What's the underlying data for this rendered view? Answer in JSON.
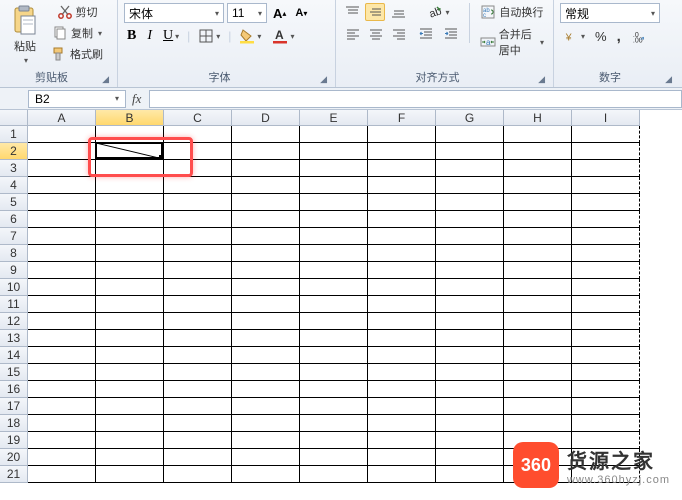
{
  "ribbon": {
    "clipboard": {
      "paste": "粘贴",
      "cut": "剪切",
      "copy": "复制",
      "format_painter": "格式刷",
      "label": "剪贴板"
    },
    "font": {
      "name": "宋体",
      "size": "11",
      "bold": "B",
      "italic": "I",
      "underline": "U",
      "label": "字体",
      "grow": "A",
      "shrink": "A"
    },
    "alignment": {
      "wrap": "自动换行",
      "merge": "合并后居中",
      "label": "对齐方式"
    },
    "number": {
      "format": "常规",
      "label": "数字"
    }
  },
  "namebox": {
    "ref": "B2"
  },
  "columns": [
    "A",
    "B",
    "C",
    "D",
    "E",
    "F",
    "G",
    "H",
    "I"
  ],
  "rows": [
    "1",
    "2",
    "3",
    "4",
    "5",
    "6",
    "7",
    "8",
    "9",
    "10",
    "11",
    "12",
    "13",
    "14",
    "15",
    "16",
    "17",
    "18",
    "19",
    "20",
    "21"
  ],
  "active": {
    "col": 1,
    "row": 1
  },
  "watermark": {
    "badge": "360",
    "title": "货源之家",
    "url": "www.360hyzj.com"
  }
}
